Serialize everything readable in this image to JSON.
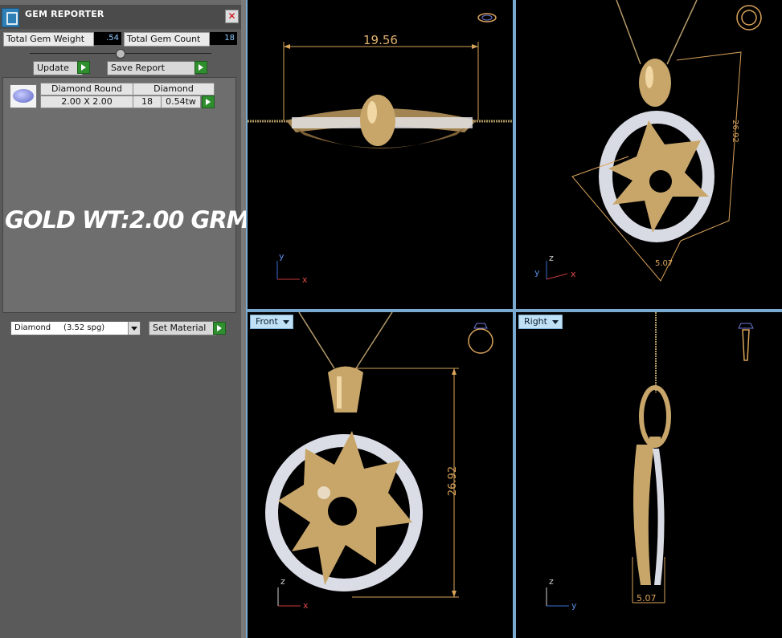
{
  "panel": {
    "title": "GEM REPORTER",
    "close_label": "✕",
    "total_weight_label": "Total Gem Weight",
    "total_weight_value": ".54",
    "total_count_label": "Total Gem Count",
    "total_count_value": "18",
    "update_label": "Update",
    "save_report_label": "Save Report",
    "gem_table": {
      "headers": [
        "Diamond Round",
        "Diamond"
      ],
      "row": {
        "size": "2.00 X 2.00",
        "count": "18",
        "weight": "0.54tw"
      }
    },
    "annotation": "GOLD WT:2.00 GRM",
    "material_select": "Diamond     (3.52 spg)",
    "set_material_label": "Set Material"
  },
  "viewports": {
    "top": {
      "dimension": "19.56",
      "axis_y": "y",
      "axis_x": "x"
    },
    "perspective": {
      "dim_height": "26.92",
      "dim_depth": "5.07",
      "axis_z": "z",
      "axis_y": "y",
      "axis_x": "x"
    },
    "front": {
      "label": "Front",
      "dimension": "26.92",
      "axis_z": "z",
      "axis_x": "x"
    },
    "right": {
      "label": "Right",
      "dimension": "5.07",
      "axis_z": "z",
      "axis_y": "y"
    }
  },
  "colors": {
    "gold": "#c8a66a",
    "dimension": "#d9a35a",
    "viewport_border": "#7aaad0"
  }
}
